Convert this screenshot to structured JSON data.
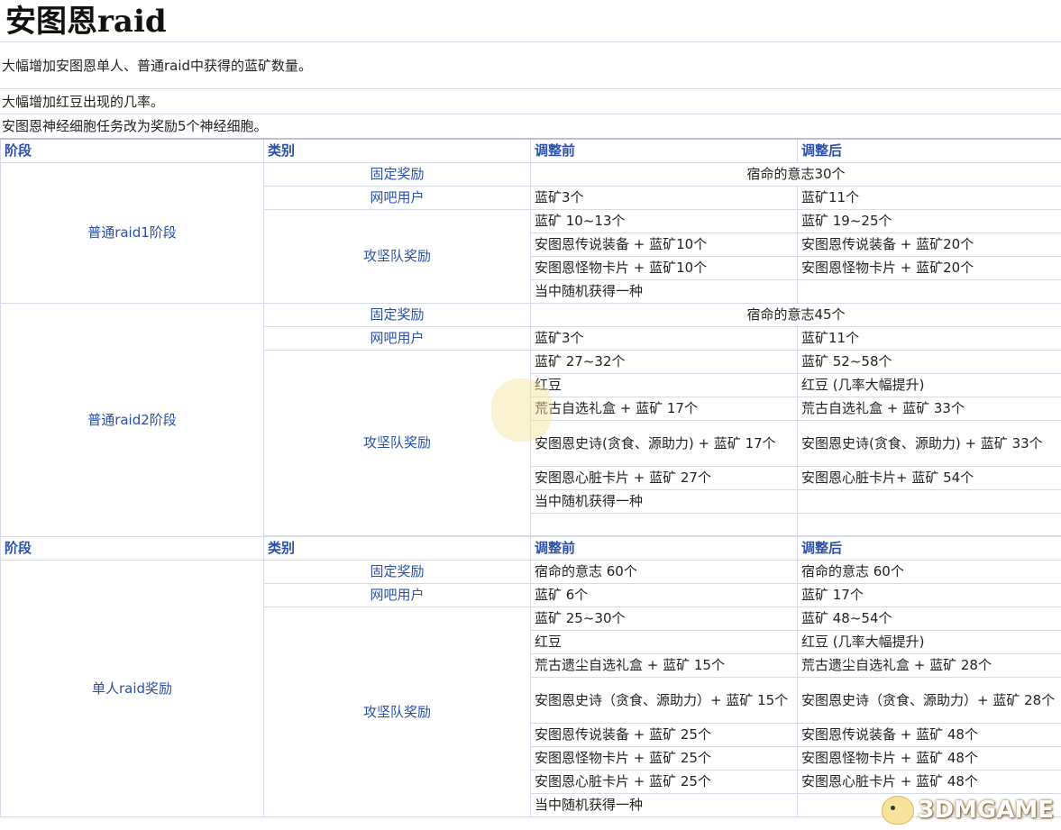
{
  "title": "安图恩raid",
  "notes": [
    "大幅增加安图恩单人、普通raid中获得的蓝矿数量。",
    "大幅增加红豆出现的几率。",
    "安图恩神经细胞任务改为奖励5个神经细胞。"
  ],
  "headers": [
    "阶段",
    "类别",
    "调整前",
    "调整后"
  ],
  "labels": {
    "fixed": "固定奖励",
    "netcafe": "网吧用户",
    "raid_team": "攻坚队奖励",
    "random": "当中随机获得一种"
  },
  "raid1": {
    "stage": "普通raid1阶段",
    "fixed": "宿命的意志30个",
    "netcafe_before": "蓝矿3个",
    "netcafe_after": "蓝矿11个",
    "rows": [
      [
        "蓝矿 10~13个",
        "蓝矿 19~25个"
      ],
      [
        "安图恩传说装备 + 蓝矿10个",
        "安图恩传说装备 + 蓝矿20个"
      ],
      [
        "安图恩怪物卡片 + 蓝矿10个",
        "安图恩怪物卡片 + 蓝矿20个"
      ]
    ]
  },
  "raid2": {
    "stage": "普通raid2阶段",
    "fixed": "宿命的意志45个",
    "netcafe_before": "蓝矿3个",
    "netcafe_after": "蓝矿11个",
    "rows": [
      [
        "蓝矿 27~32个",
        "蓝矿 52~58个"
      ],
      [
        "红豆",
        "红豆 (几率大幅提升)"
      ],
      [
        "荒古自选礼盒 + 蓝矿 17个",
        "荒古自选礼盒 + 蓝矿 33个"
      ],
      [
        "安图恩史诗(贪食、源助力) + 蓝矿 17个",
        "安图恩史诗(贪食、源助力) + 蓝矿 33个"
      ],
      [
        "安图恩心脏卡片 + 蓝矿 27个",
        "安图恩心脏卡片+ 蓝矿 54个"
      ]
    ]
  },
  "solo": {
    "stage": "单人raid奖励",
    "fixed_before": "宿命的意志 60个",
    "fixed_after": "宿命的意志 60个",
    "netcafe_before": "蓝矿 6个",
    "netcafe_after": "蓝矿 17个",
    "rows": [
      [
        "蓝矿 25~30个",
        "蓝矿 48~54个"
      ],
      [
        "红豆",
        "红豆 (几率大幅提升)"
      ],
      [
        "荒古遗尘自选礼盒 + 蓝矿 15个",
        "荒古遗尘自选礼盒 + 蓝矿 28个"
      ],
      [
        "安图恩史诗（贪食、源助力）+ 蓝矿 15个",
        "安图恩史诗（贪食、源助力）+ 蓝矿 28个"
      ],
      [
        "安图恩传说装备 + 蓝矿 25个",
        "安图恩传说装备 + 蓝矿 48个"
      ],
      [
        "安图恩怪物卡片 + 蓝矿 25个",
        "安图恩怪物卡片 + 蓝矿 48个"
      ],
      [
        "安图恩心脏卡片 + 蓝矿 25个",
        "安图恩心脏卡片 + 蓝矿 48个"
      ]
    ]
  },
  "watermark": "3DMGAME"
}
